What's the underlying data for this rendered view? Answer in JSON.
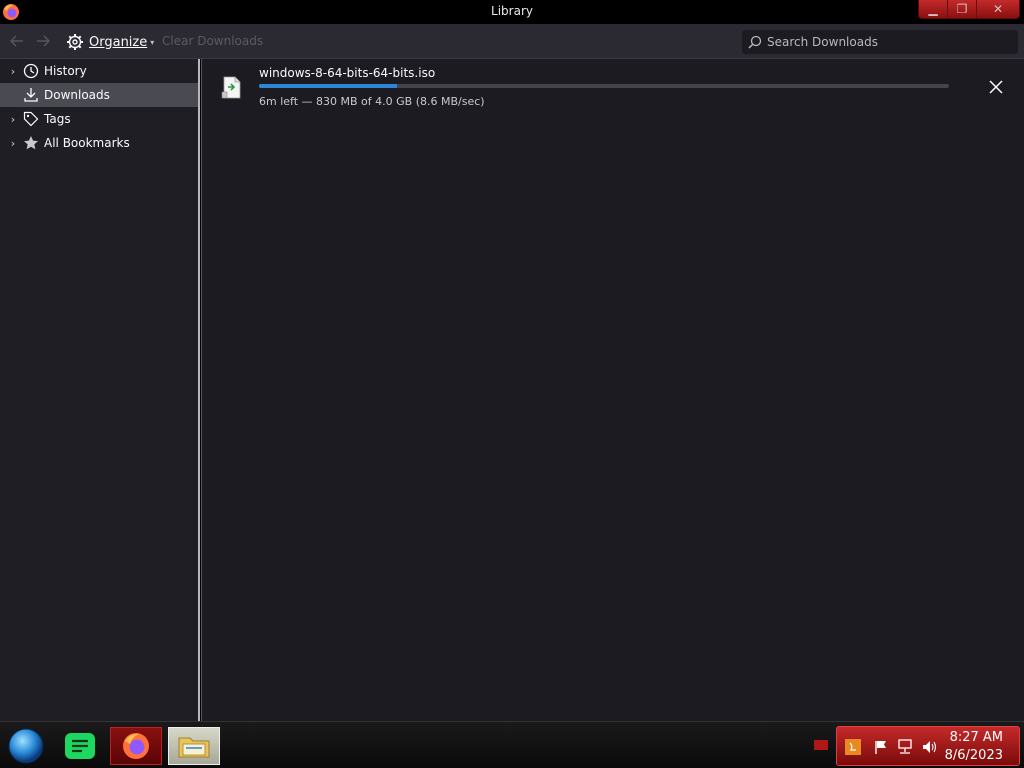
{
  "window": {
    "title": "Library",
    "controls": [
      "minimize",
      "restore",
      "close"
    ]
  },
  "toolbar": {
    "back_icon": "arrow-left-icon",
    "forward_icon": "arrow-right-icon",
    "organize_label": "Organize",
    "clear_label": "Clear Downloads",
    "search_placeholder": "Search Downloads"
  },
  "sidebar": {
    "items": [
      {
        "label": "History",
        "icon": "clock-icon",
        "expandable": true,
        "selected": false
      },
      {
        "label": "Downloads",
        "icon": "download-icon",
        "expandable": false,
        "selected": true
      },
      {
        "label": "Tags",
        "icon": "tag-icon",
        "expandable": true,
        "selected": false
      },
      {
        "label": "All Bookmarks",
        "icon": "star-icon",
        "expandable": true,
        "selected": false
      }
    ]
  },
  "downloads": [
    {
      "filename": "windows-8-64-bits-64-bits.iso",
      "status": "6m left — 830 MB of 4.0 GB (8.6 MB/sec)",
      "progress": 0.2
    }
  ],
  "taskbar": {
    "apps": [
      "start-orb",
      "spotify",
      "firefox",
      "file-explorer"
    ],
    "clock_time": "8:27 AM",
    "clock_date": "8/6/2023"
  },
  "colors": {
    "accent": "#2f86d6",
    "window_bg": "#1c1b22",
    "toolbar_bg": "#2b2a33",
    "theme_red": "#c42a2a"
  }
}
